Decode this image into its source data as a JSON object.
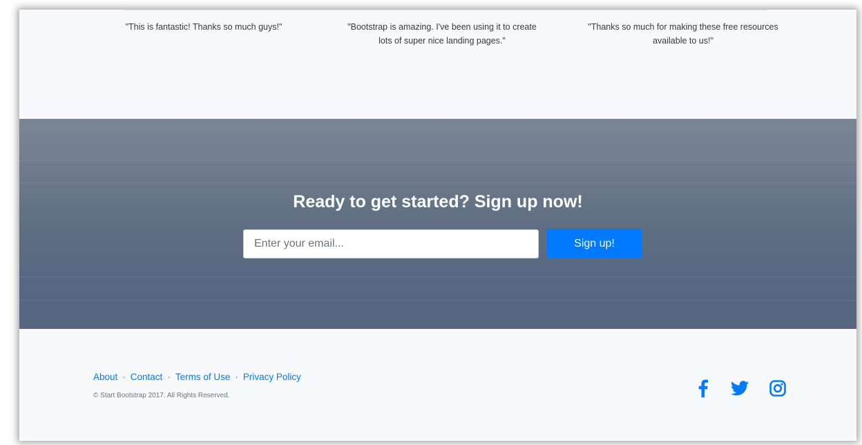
{
  "testimonials": [
    {
      "quote": "\"This is fantastic! Thanks so much guys!\""
    },
    {
      "quote": "\"Bootstrap is amazing. I've been using it to create lots of super nice landing pages.\""
    },
    {
      "quote": "\"Thanks so much for making these free resources available to us!\""
    }
  ],
  "cta": {
    "title": "Ready to get started? Sign up now!",
    "email_placeholder": "Enter your email...",
    "email_value": "",
    "signup_label": "Sign up!"
  },
  "footer": {
    "links": [
      "About",
      "Contact",
      "Terms of Use",
      "Privacy Policy"
    ],
    "separator": "·",
    "copyright": "© Start Bootstrap 2017. All Rights Reserved.",
    "social": [
      "facebook-icon",
      "twitter-icon",
      "instagram-icon"
    ]
  },
  "colors": {
    "accent": "#007bff",
    "background": "#f8f9fa",
    "cta_overlay": "#5f6e82"
  }
}
